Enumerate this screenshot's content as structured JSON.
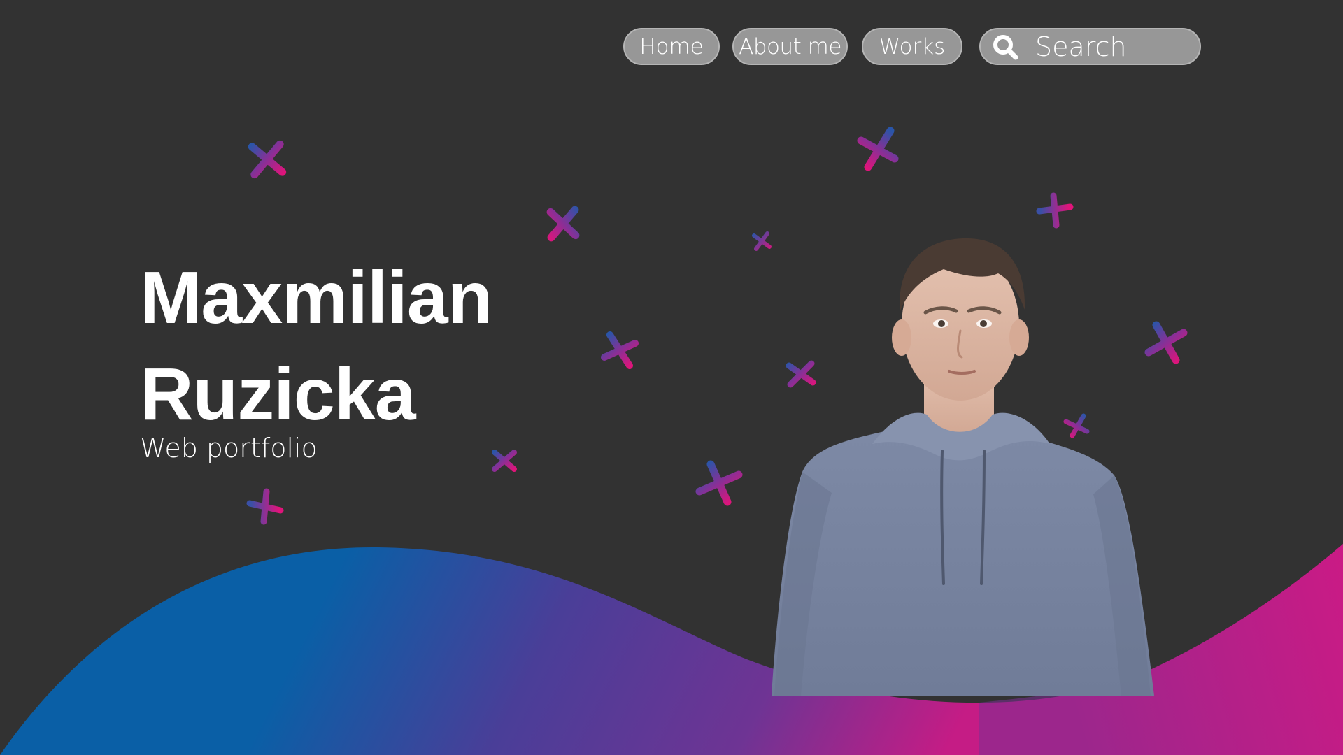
{
  "nav": {
    "home_label": "Home",
    "about_label": "About me",
    "works_label": "Works",
    "search_placeholder": "Search"
  },
  "hero": {
    "first_name": "Maxmilian",
    "last_name": "Ruzicka",
    "subtitle": "Web portfolio"
  },
  "icons": {
    "search": "search-icon",
    "decor": "cross-icon",
    "portrait": "portrait-photo"
  },
  "colors": {
    "background": "#323232",
    "pill": "#979797",
    "text": "#ffffff",
    "gradient_blue": "#0a5fa6",
    "gradient_purple": "#6b3a99",
    "gradient_pink": "#d4187f"
  }
}
